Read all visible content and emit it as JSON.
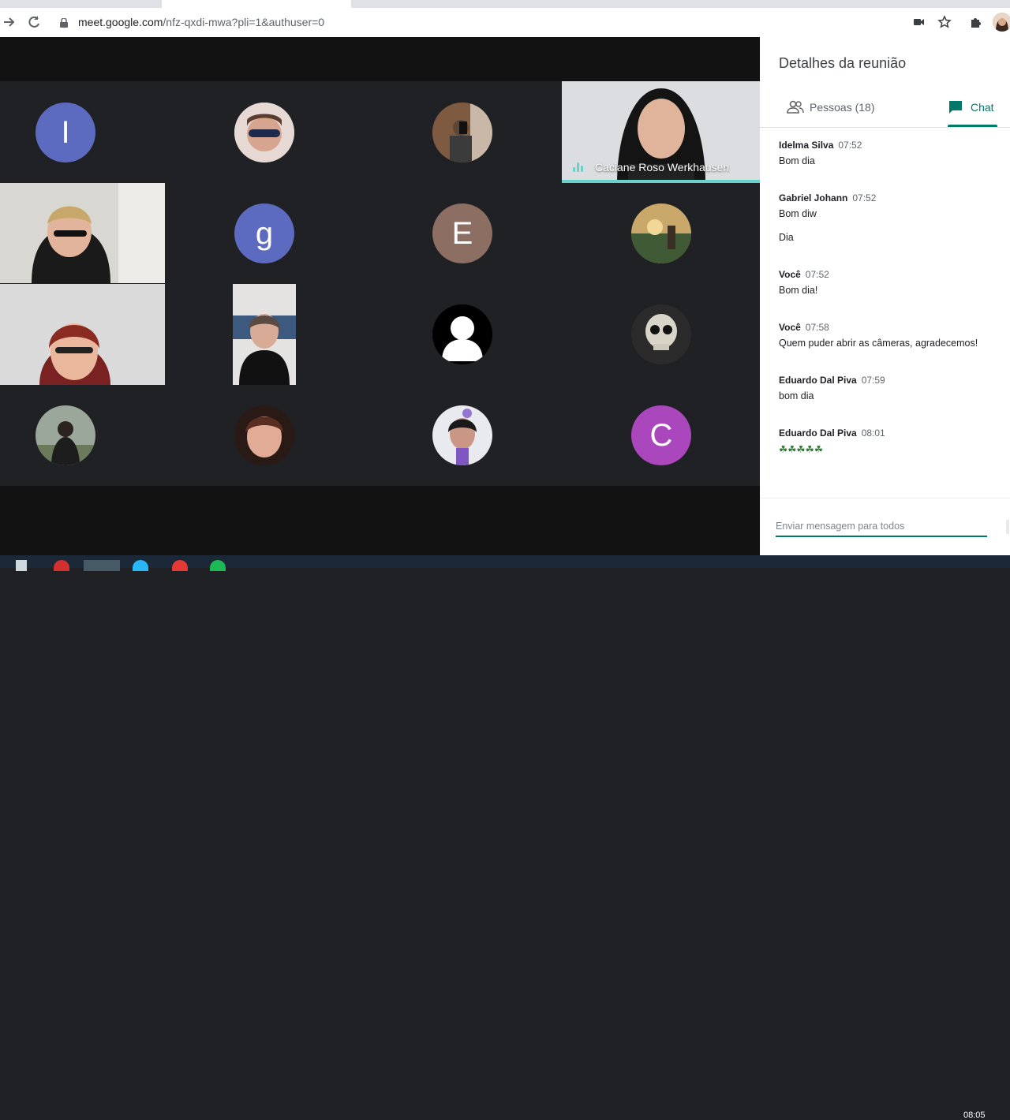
{
  "browser": {
    "url_host": "meet.google.com",
    "url_path": "/nfz-qxdi-mwa?pli=1&authuser=0"
  },
  "meeting": {
    "speaker_name": "Caciane Roso Werkhausen",
    "tiles": [
      {
        "letter": "I",
        "color": "#5c6bc0"
      },
      {
        "letter": "g",
        "color": "#5c6bc0"
      },
      {
        "letter": "E",
        "color": "#8d6e63"
      },
      {
        "letter": "C",
        "color": "#ab47bc"
      }
    ]
  },
  "panel": {
    "title": "Detalhes da reunião",
    "people_tab": "Pessoas (18)",
    "chat_tab": "Chat",
    "messages": [
      {
        "sender": "Idelma Silva",
        "time": "07:52",
        "lines": [
          "Bom dia"
        ]
      },
      {
        "sender": "Gabriel Johann",
        "time": "07:52",
        "lines": [
          "Bom diw",
          "Dia"
        ]
      },
      {
        "sender": "Você",
        "time": "07:52",
        "lines": [
          "Bom dia!"
        ]
      },
      {
        "sender": "Você",
        "time": "07:58",
        "lines": [
          "Quem puder abrir as câmeras, agradecemos!"
        ]
      },
      {
        "sender": "Eduardo Dal Piva",
        "time": "07:59",
        "lines": [
          "bom dia"
        ]
      },
      {
        "sender": "Eduardo Dal Piva",
        "time": "08:01",
        "lines": [
          "☘☘☘☘☘"
        ]
      }
    ],
    "input_placeholder": "Enviar mensagem para todos"
  },
  "taskbar": {
    "clock": "08:05"
  },
  "colors": {
    "accent": "#00796b",
    "speaking": "#6ad1c9"
  }
}
